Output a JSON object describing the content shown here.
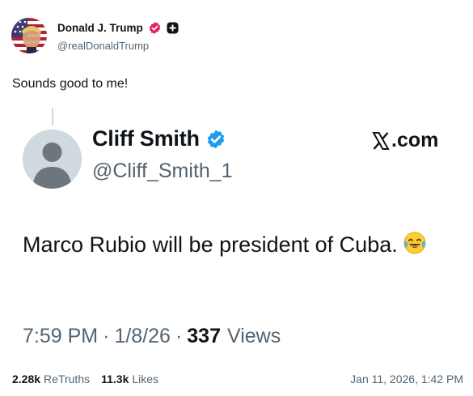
{
  "author": {
    "display_name": "Donald J. Trump",
    "handle": "@realDonaldTrump",
    "verified_color": "#e0245e"
  },
  "post": {
    "text": "Sounds good to me!"
  },
  "quoted": {
    "display_name": "Cliff Smith",
    "handle": "@Cliff_Smith_1",
    "source": ".com",
    "text": "Marco Rubio will be president of Cuba.",
    "emoji": "tears-of-joy-emoji",
    "time": "7:59 PM",
    "date": "1/8/26",
    "views_count": "337",
    "views_label": "Views",
    "verified_color": "#1d9bf0"
  },
  "stats": {
    "retruths_count": "2.28k",
    "retruths_label": "ReTruths",
    "likes_count": "11.3k",
    "likes_label": "Likes",
    "timestamp": "Jan 11, 2026, 1:42 PM"
  }
}
